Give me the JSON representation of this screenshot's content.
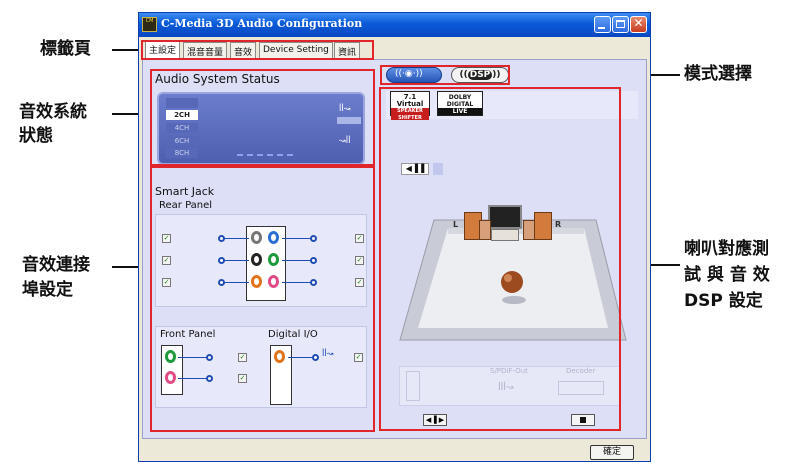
{
  "window": {
    "title": "C-Media 3D Audio Configuration",
    "app_icon": "cmedia-logo-icon",
    "ok_button": "確定"
  },
  "tabs": [
    {
      "label": "主設定",
      "active": true
    },
    {
      "label": "混音音量"
    },
    {
      "label": "音效"
    },
    {
      "label": "Device Setting"
    },
    {
      "label": "資訊"
    }
  ],
  "status_panel": {
    "title": "Audio System Status",
    "channels": [
      "2CH",
      "4CH",
      "6CH",
      "8CH"
    ],
    "active_channel": "2CH"
  },
  "smart_jack": {
    "title": "Smart Jack",
    "rear_panel_label": "Rear Panel",
    "front_panel_label": "Front Panel",
    "digital_label": "Digital I/O"
  },
  "mode_buttons": [
    "speaker-mode-button",
    "dsp-mode-button"
  ],
  "mode_button_labels": {
    "dsp": "DSP"
  },
  "virtual_badge": {
    "top": "7.1",
    "middle": "Virtual",
    "bottom": "SPEAKER SHIFTER"
  },
  "dolby_badge": {
    "top": "DOLBY",
    "middle": "DIGITAL",
    "bottom": "LIVE"
  },
  "speaker_labels": {
    "left": "L",
    "right": "R"
  },
  "bottom_labels": {
    "spdif": "S/PDIF-Out",
    "decoder": "Decoder"
  },
  "callouts": {
    "tabs": "標籤頁",
    "status": [
      "音效系統",
      "狀態"
    ],
    "jack": [
      "音效連接",
      "埠設定"
    ],
    "mode": "模式選擇",
    "speaker": [
      "喇叭對應測",
      "試 與 音 效",
      "DSP 設定"
    ]
  }
}
